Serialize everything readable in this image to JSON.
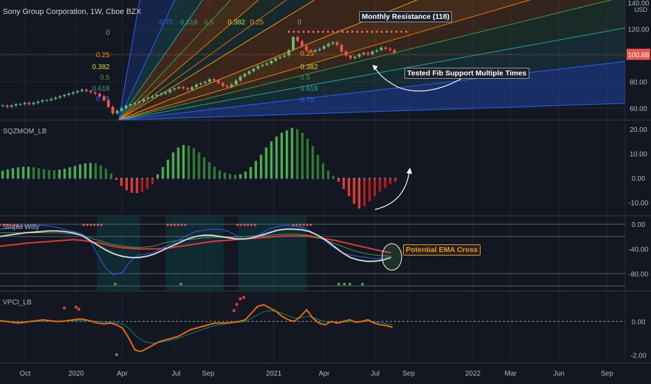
{
  "header": {
    "title": "Sony Group Corporation, 1W, Cboe BZX"
  },
  "colors": {
    "bg": "#131722",
    "grid": "#1f2433",
    "up": "#26a69a",
    "down": "#ef5350",
    "sqz_up": "#4caf50",
    "sqz_down": "#c62828",
    "ema_red": "#e53935",
    "ema_green": "#43a047",
    "white_line": "#d1d4dc",
    "blue_line": "#2962ff",
    "orange_line": "#f57c00",
    "teal_line": "#00897b"
  },
  "annotations": {
    "monthly_resistance": "Monthly Resistance (118)",
    "tested_fib": "Tested Fib Support Multiple Times",
    "ema_cross": "Potential EMA Cross"
  },
  "panes": {
    "squeeze": "SQZMOM_LB",
    "stupid": "Stupid Willy",
    "vpci": "VPCI_LB"
  },
  "price_axis": {
    "unit": "USD",
    "last_price": "100.88"
  },
  "chart_data": [
    {
      "type": "candlestick",
      "title": "Sony Group Corporation, 1W, Cboe BZX",
      "x_ticks": [
        "Oct",
        "2020",
        "Apr",
        "Jul",
        "Sep",
        "2021",
        "Apr",
        "Jul",
        "Sep",
        "2022",
        "Mar",
        "Jun",
        "Sep"
      ],
      "y_ticks": [
        "140.00",
        "120.00",
        "100.88",
        "80.00",
        "60.00"
      ],
      "ylim": [
        52,
        140
      ],
      "close": [
        62,
        61,
        62,
        63,
        63,
        64,
        63,
        64,
        65,
        66,
        66,
        67,
        68,
        69,
        70,
        71,
        72,
        73,
        74,
        73,
        72,
        71,
        69,
        66,
        61,
        56,
        58,
        60,
        62,
        63,
        64,
        65,
        67,
        68,
        69,
        70,
        71,
        72,
        74,
        75,
        76,
        75,
        74,
        76,
        78,
        79,
        80,
        82,
        81,
        79,
        77,
        76,
        78,
        81,
        84,
        86,
        88,
        90,
        92,
        93,
        94,
        96,
        98,
        99,
        100,
        104,
        114,
        111,
        107,
        104,
        103,
        104,
        105,
        107,
        109,
        110,
        108,
        103,
        100,
        98,
        99,
        101,
        102,
        101,
        103,
        104,
        106,
        105,
        104,
        102
      ],
      "monthly_resistance": 118,
      "fib_fan_levels": [
        "0",
        "0.25",
        "0.382",
        "0.5",
        "0.618",
        "0.75"
      ],
      "fib_top_labels": [
        "0.75",
        "0.618",
        "0.5",
        "0.382",
        "0.25",
        "0"
      ]
    },
    {
      "type": "bar",
      "title": "SQZMOM_LB",
      "y_ticks": [
        "20.00",
        "10.00",
        "0.00",
        "-10.00"
      ],
      "ylim": [
        -14,
        22
      ],
      "values": [
        3,
        3.5,
        4,
        4.4,
        4.6,
        4.6,
        4.4,
        4,
        3.6,
        3.3,
        3.2,
        3.4,
        3.8,
        4.4,
        5,
        5.6,
        6,
        6.2,
        6,
        5.2,
        3.8,
        1.8,
        -0.8,
        -3.2,
        -5,
        -6,
        -6.2,
        -5.6,
        -4.4,
        -2.6,
        1.5,
        4.5,
        7.5,
        10.5,
        12.5,
        13.5,
        13.3,
        12.2,
        10.5,
        8.5,
        6.5,
        4.7,
        3.2,
        2.2,
        1.7,
        1.4,
        1.6,
        2.6,
        4.5,
        7,
        9.5,
        12.5,
        15,
        17,
        18.5,
        19.5,
        20.5,
        20,
        18.5,
        16,
        13,
        9.5,
        6,
        3,
        0.8,
        -1.5,
        -4.5,
        -7.5,
        -10.5,
        -12.5,
        -11.5,
        -9.5,
        -7.5,
        -5.5,
        -4,
        -2.5,
        -1.5
      ]
    },
    {
      "type": "line",
      "title": "Stupid Willy",
      "y_ticks": [
        "0.00",
        "-40.00",
        "-80.00"
      ],
      "ylim": [
        -105,
        8
      ],
      "series": [
        {
          "values": [
            -8,
            -6,
            -4,
            -3,
            -2,
            -2,
            -3,
            -5,
            -9,
            -12,
            -15,
            -25,
            -50,
            -72,
            -82,
            -78,
            -60,
            -50,
            -48,
            -45,
            -38,
            -32,
            -25,
            -18,
            -12,
            -10,
            -8,
            -8,
            -12,
            -18,
            -24,
            -22,
            -15,
            -8,
            -4,
            -2,
            -3,
            -5,
            -10,
            -18,
            -28,
            -38,
            -46,
            -50,
            -52,
            -54,
            -56,
            -55,
            -54
          ]
        },
        {
          "values": [
            -20,
            -18,
            -16,
            -14,
            -13,
            -12,
            -11,
            -11,
            -12,
            -14,
            -18,
            -26,
            -34,
            -42,
            -48,
            -52,
            -54,
            -54,
            -52,
            -48,
            -42,
            -36,
            -30,
            -24,
            -20,
            -18,
            -18,
            -20,
            -22,
            -24,
            -24,
            -22,
            -18,
            -14,
            -10,
            -8,
            -8,
            -9,
            -12,
            -18,
            -26,
            -36,
            -46,
            -54,
            -58,
            -60,
            -60,
            -58,
            -54
          ]
        },
        {
          "values": [
            -36,
            -34,
            -33,
            -31,
            -30,
            -29,
            -28,
            -27,
            -26,
            -25,
            -26,
            -28,
            -30,
            -33,
            -36,
            -38,
            -39,
            -40,
            -40,
            -40,
            -39,
            -38,
            -36,
            -34,
            -32,
            -30,
            -28,
            -27,
            -26,
            -25,
            -24,
            -23,
            -22,
            -21,
            -20,
            -19,
            -19,
            -19,
            -20,
            -22,
            -24,
            -26,
            -29,
            -32,
            -35,
            -38,
            -41,
            -44,
            -46
          ]
        },
        {
          "values": [
            -14,
            -14,
            -14,
            -14,
            -14,
            -14,
            -14,
            -14,
            -15,
            -16,
            -18,
            -22,
            -26,
            -30,
            -33,
            -35,
            -37,
            -38,
            -37,
            -35,
            -31,
            -28,
            -26,
            -25,
            -24,
            -22,
            -21,
            -21,
            -21,
            -21,
            -20,
            -19,
            -19,
            -18,
            -17,
            -16,
            -16,
            -17,
            -18,
            -22,
            -26,
            -31,
            -36,
            -41,
            -45,
            -48,
            -50,
            -51,
            -52
          ]
        }
      ]
    },
    {
      "type": "line",
      "title": "VPCI_LB",
      "y_ticks": [
        "0.00",
        "-2.00"
      ],
      "ylim": [
        -2.4,
        1.6
      ],
      "series": [
        {
          "values": [
            0.05,
            0.0,
            -0.05,
            -0.1,
            -0.05,
            0.0,
            0.05,
            0.1,
            0.05,
            0.0,
            0.0,
            0.05,
            0.1,
            0.15,
            0.1,
            0.0,
            -0.1,
            -0.15,
            -0.1,
            -0.2,
            -0.4,
            -1.0,
            -1.7,
            -1.8,
            -1.6,
            -1.4,
            -1.2,
            -1.1,
            -1.0,
            -0.9,
            -0.7,
            -0.5,
            -0.4,
            -0.3,
            -0.2,
            -0.1,
            -0.1,
            -0.1,
            -0.05,
            0.0,
            0.1,
            0.5,
            0.9,
            1.0,
            0.8,
            0.6,
            0.3,
            0.1,
            0.0,
            0.3,
            0.7,
            0.2,
            -0.1,
            -0.2,
            0.0,
            -0.1,
            0.0,
            0.1,
            -0.05,
            0.0,
            0.1,
            -0.1,
            -0.2,
            -0.25,
            -0.35
          ]
        },
        {
          "values": [
            0.0,
            0.0,
            -0.02,
            -0.04,
            -0.04,
            -0.02,
            0.0,
            0.02,
            0.03,
            0.02,
            0.02,
            0.03,
            0.05,
            0.06,
            0.05,
            0.03,
            0.0,
            -0.03,
            -0.05,
            -0.08,
            -0.15,
            -0.4,
            -0.8,
            -1.1,
            -1.25,
            -1.3,
            -1.25,
            -1.18,
            -1.1,
            -1.0,
            -0.88,
            -0.74,
            -0.6,
            -0.48,
            -0.36,
            -0.26,
            -0.18,
            -0.12,
            -0.08,
            -0.04,
            0.0,
            0.18,
            0.4,
            0.58,
            0.64,
            0.6,
            0.48,
            0.34,
            0.2,
            0.2,
            0.3,
            0.25,
            0.1,
            -0.02,
            -0.05,
            -0.06,
            -0.04,
            0.0,
            0.0,
            0.0,
            0.02,
            -0.02,
            -0.08,
            -0.14,
            -0.2
          ]
        }
      ]
    }
  ]
}
